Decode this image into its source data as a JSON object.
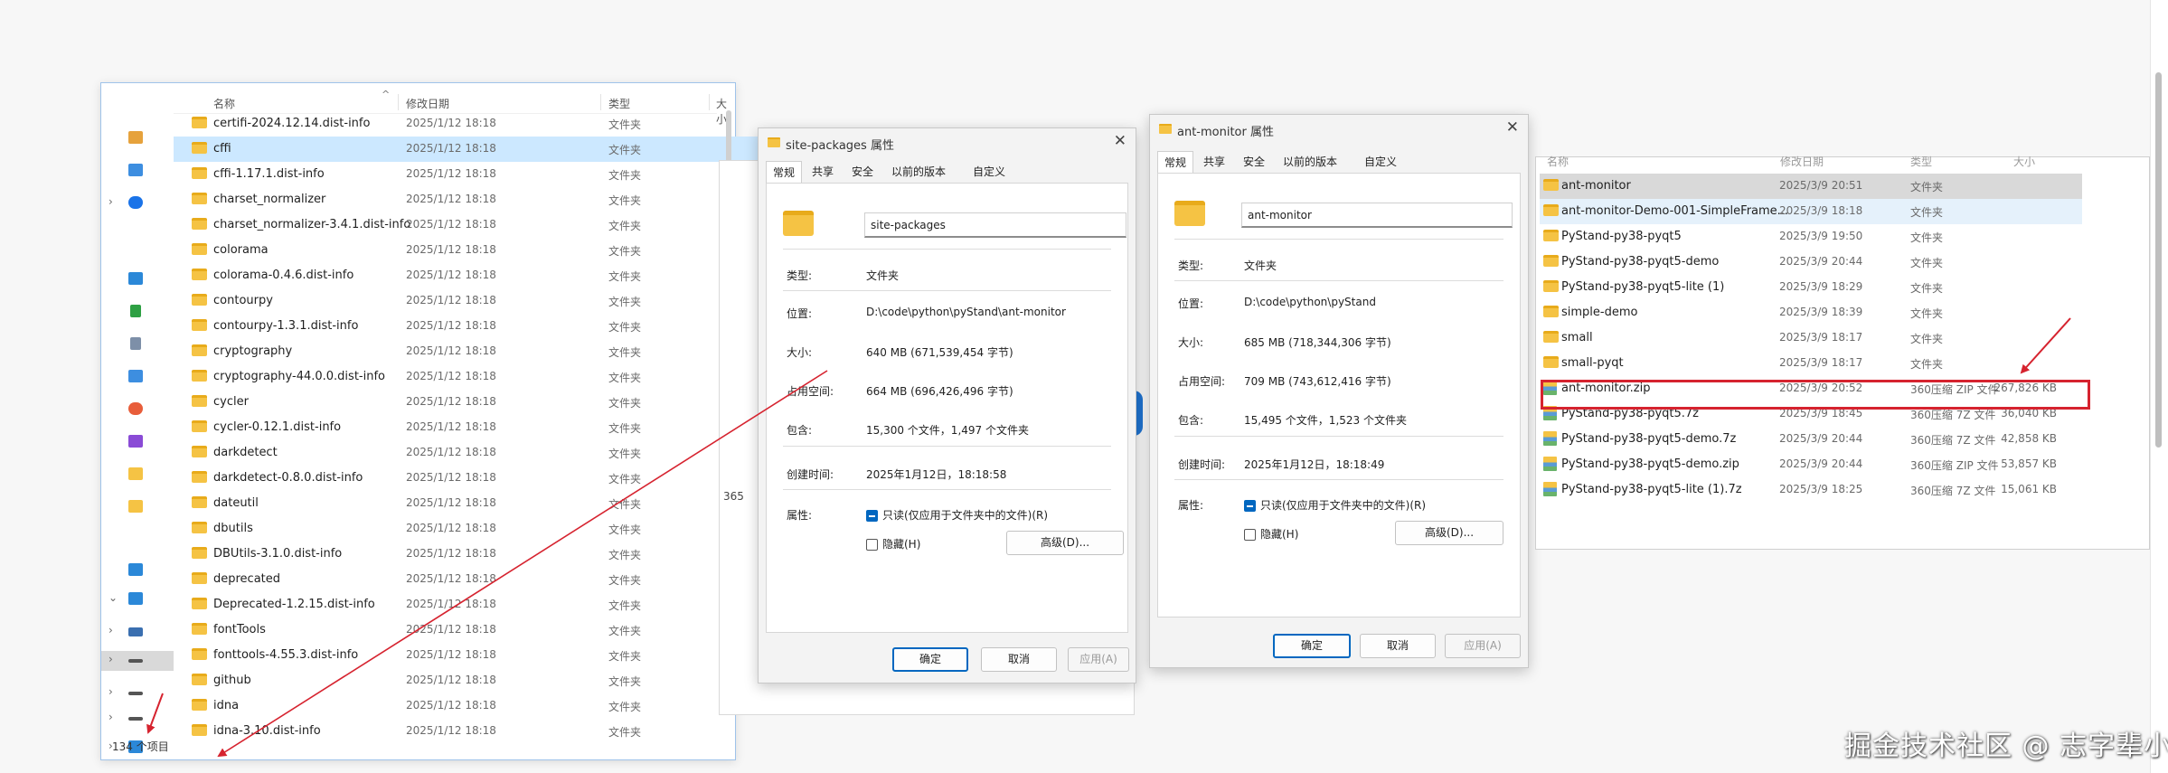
{
  "explorer1": {
    "headers": {
      "name": "名称",
      "date": "修改日期",
      "type": "类型",
      "size": "大小"
    },
    "rows": [
      {
        "name": "certifi-2024.12.14.dist-info",
        "date": "2025/1/12 18:18",
        "type": "文件夹"
      },
      {
        "name": "cffi",
        "date": "2025/1/12 18:18",
        "type": "文件夹"
      },
      {
        "name": "cffi-1.17.1.dist-info",
        "date": "2025/1/12 18:18",
        "type": "文件夹"
      },
      {
        "name": "charset_normalizer",
        "date": "2025/1/12 18:18",
        "type": "文件夹"
      },
      {
        "name": "charset_normalizer-3.4.1.dist-info",
        "date": "2025/1/12 18:18",
        "type": "文件夹"
      },
      {
        "name": "colorama",
        "date": "2025/1/12 18:18",
        "type": "文件夹"
      },
      {
        "name": "colorama-0.4.6.dist-info",
        "date": "2025/1/12 18:18",
        "type": "文件夹"
      },
      {
        "name": "contourpy",
        "date": "2025/1/12 18:18",
        "type": "文件夹"
      },
      {
        "name": "contourpy-1.3.1.dist-info",
        "date": "2025/1/12 18:18",
        "type": "文件夹"
      },
      {
        "name": "cryptography",
        "date": "2025/1/12 18:18",
        "type": "文件夹"
      },
      {
        "name": "cryptography-44.0.0.dist-info",
        "date": "2025/1/12 18:18",
        "type": "文件夹"
      },
      {
        "name": "cycler",
        "date": "2025/1/12 18:18",
        "type": "文件夹"
      },
      {
        "name": "cycler-0.12.1.dist-info",
        "date": "2025/1/12 18:18",
        "type": "文件夹"
      },
      {
        "name": "darkdetect",
        "date": "2025/1/12 18:18",
        "type": "文件夹"
      },
      {
        "name": "darkdetect-0.8.0.dist-info",
        "date": "2025/1/12 18:18",
        "type": "文件夹"
      },
      {
        "name": "dateutil",
        "date": "2025/1/12 18:18",
        "type": "文件夹"
      },
      {
        "name": "dbutils",
        "date": "2025/1/12 18:18",
        "type": "文件夹"
      },
      {
        "name": "DBUtils-3.1.0.dist-info",
        "date": "2025/1/12 18:18",
        "type": "文件夹"
      },
      {
        "name": "deprecated",
        "date": "2025/1/12 18:18",
        "type": "文件夹"
      },
      {
        "name": "Deprecated-1.2.15.dist-info",
        "date": "2025/1/12 18:18",
        "type": "文件夹"
      },
      {
        "name": "fontTools",
        "date": "2025/1/12 18:18",
        "type": "文件夹"
      },
      {
        "name": "fonttools-4.55.3.dist-info",
        "date": "2025/1/12 18:18",
        "type": "文件夹"
      },
      {
        "name": "github",
        "date": "2025/1/12 18:18",
        "type": "文件夹"
      },
      {
        "name": "idna",
        "date": "2025/1/12 18:18",
        "type": "文件夹"
      },
      {
        "name": "idna-3.10.dist-info",
        "date": "2025/1/12 18:18",
        "type": "文件夹"
      }
    ],
    "status": "134 个项目"
  },
  "background_window_text": "365",
  "dialog1": {
    "title": "site-packages 属性",
    "tabs": [
      "常规",
      "共享",
      "安全",
      "以前的版本",
      "自定义"
    ],
    "name_value": "site-packages",
    "props": [
      {
        "label": "类型:",
        "value": "文件夹"
      },
      {
        "label": "位置:",
        "value": "D:\\code\\python\\pyStand\\ant-monitor"
      },
      {
        "label": "大小:",
        "value": "640 MB (671,539,454 字节)"
      },
      {
        "label": "占用空间:",
        "value": "664 MB (696,426,496 字节)"
      },
      {
        "label": "包含:",
        "value": "15,300 个文件，1,497 个文件夹"
      },
      {
        "label": "创建时间:",
        "value": "2025年1月12日，18:18:58"
      }
    ],
    "attributes_label": "属性:",
    "readonly_label": "只读(仅应用于文件夹中的文件)(R)",
    "hidden_label": "隐藏(H)",
    "advanced_label": "高级(D)...",
    "ok": "确定",
    "cancel": "取消",
    "apply": "应用(A)"
  },
  "dialog2": {
    "title": "ant-monitor 属性",
    "tabs": [
      "常规",
      "共享",
      "安全",
      "以前的版本",
      "自定义"
    ],
    "name_value": "ant-monitor",
    "props": [
      {
        "label": "类型:",
        "value": "文件夹"
      },
      {
        "label": "位置:",
        "value": "D:\\code\\python\\pyStand"
      },
      {
        "label": "大小:",
        "value": "685 MB (718,344,306 字节)"
      },
      {
        "label": "占用空间:",
        "value": "709 MB (743,612,416 字节)"
      },
      {
        "label": "包含:",
        "value": "15,495 个文件，1,523 个文件夹"
      },
      {
        "label": "创建时间:",
        "value": "2025年1月12日，18:18:49"
      }
    ],
    "attributes_label": "属性:",
    "readonly_label": "只读(仅应用于文件夹中的文件)(R)",
    "hidden_label": "隐藏(H)",
    "advanced_label": "高级(D)...",
    "ok": "确定",
    "cancel": "取消",
    "apply": "应用(A)"
  },
  "explorer2": {
    "headers": {
      "name": "名称",
      "date": "修改日期",
      "type": "类型",
      "size": "大小"
    },
    "rows": [
      {
        "name": "ant-monitor",
        "date": "2025/3/9 20:51",
        "type": "文件夹",
        "size": "",
        "kind": "folder"
      },
      {
        "name": "ant-monitor-Demo-001-SimpleFrame...",
        "date": "2025/3/9 18:18",
        "type": "文件夹",
        "size": "",
        "kind": "folder"
      },
      {
        "name": "PyStand-py38-pyqt5",
        "date": "2025/3/9 19:50",
        "type": "文件夹",
        "size": "",
        "kind": "folder"
      },
      {
        "name": "PyStand-py38-pyqt5-demo",
        "date": "2025/3/9 20:44",
        "type": "文件夹",
        "size": "",
        "kind": "folder"
      },
      {
        "name": "PyStand-py38-pyqt5-lite (1)",
        "date": "2025/3/9 18:29",
        "type": "文件夹",
        "size": "",
        "kind": "folder"
      },
      {
        "name": "simple-demo",
        "date": "2025/3/9 18:39",
        "type": "文件夹",
        "size": "",
        "kind": "folder"
      },
      {
        "name": "small",
        "date": "2025/3/9 18:17",
        "type": "文件夹",
        "size": "",
        "kind": "folder"
      },
      {
        "name": "small-pyqt",
        "date": "2025/3/9 18:17",
        "type": "文件夹",
        "size": "",
        "kind": "folder"
      },
      {
        "name": "ant-monitor.zip",
        "date": "2025/3/9 20:52",
        "type": "360压缩 ZIP 文件",
        "size": "267,826 KB",
        "kind": "zip"
      },
      {
        "name": "PyStand-py38-pyqt5.7z",
        "date": "2025/3/9 18:45",
        "type": "360压缩 7Z 文件",
        "size": "36,040 KB",
        "kind": "zip"
      },
      {
        "name": "PyStand-py38-pyqt5-demo.7z",
        "date": "2025/3/9 20:44",
        "type": "360压缩 7Z 文件",
        "size": "42,858 KB",
        "kind": "zip"
      },
      {
        "name": "PyStand-py38-pyqt5-demo.zip",
        "date": "2025/3/9 20:44",
        "type": "360压缩 ZIP 文件",
        "size": "53,857 KB",
        "kind": "zip"
      },
      {
        "name": "PyStand-py38-pyqt5-lite (1).7z",
        "date": "2025/3/9 18:25",
        "type": "360压缩 7Z 文件",
        "size": "15,061 KB",
        "kind": "zip"
      }
    ]
  },
  "watermark": "掘金技术社区 @ 志字辈小蚂蚁",
  "colors": {
    "accent": "#0067c0",
    "annotation_red": "#d6232f",
    "selection": "#cce8ff",
    "folder": "#f5c344"
  }
}
